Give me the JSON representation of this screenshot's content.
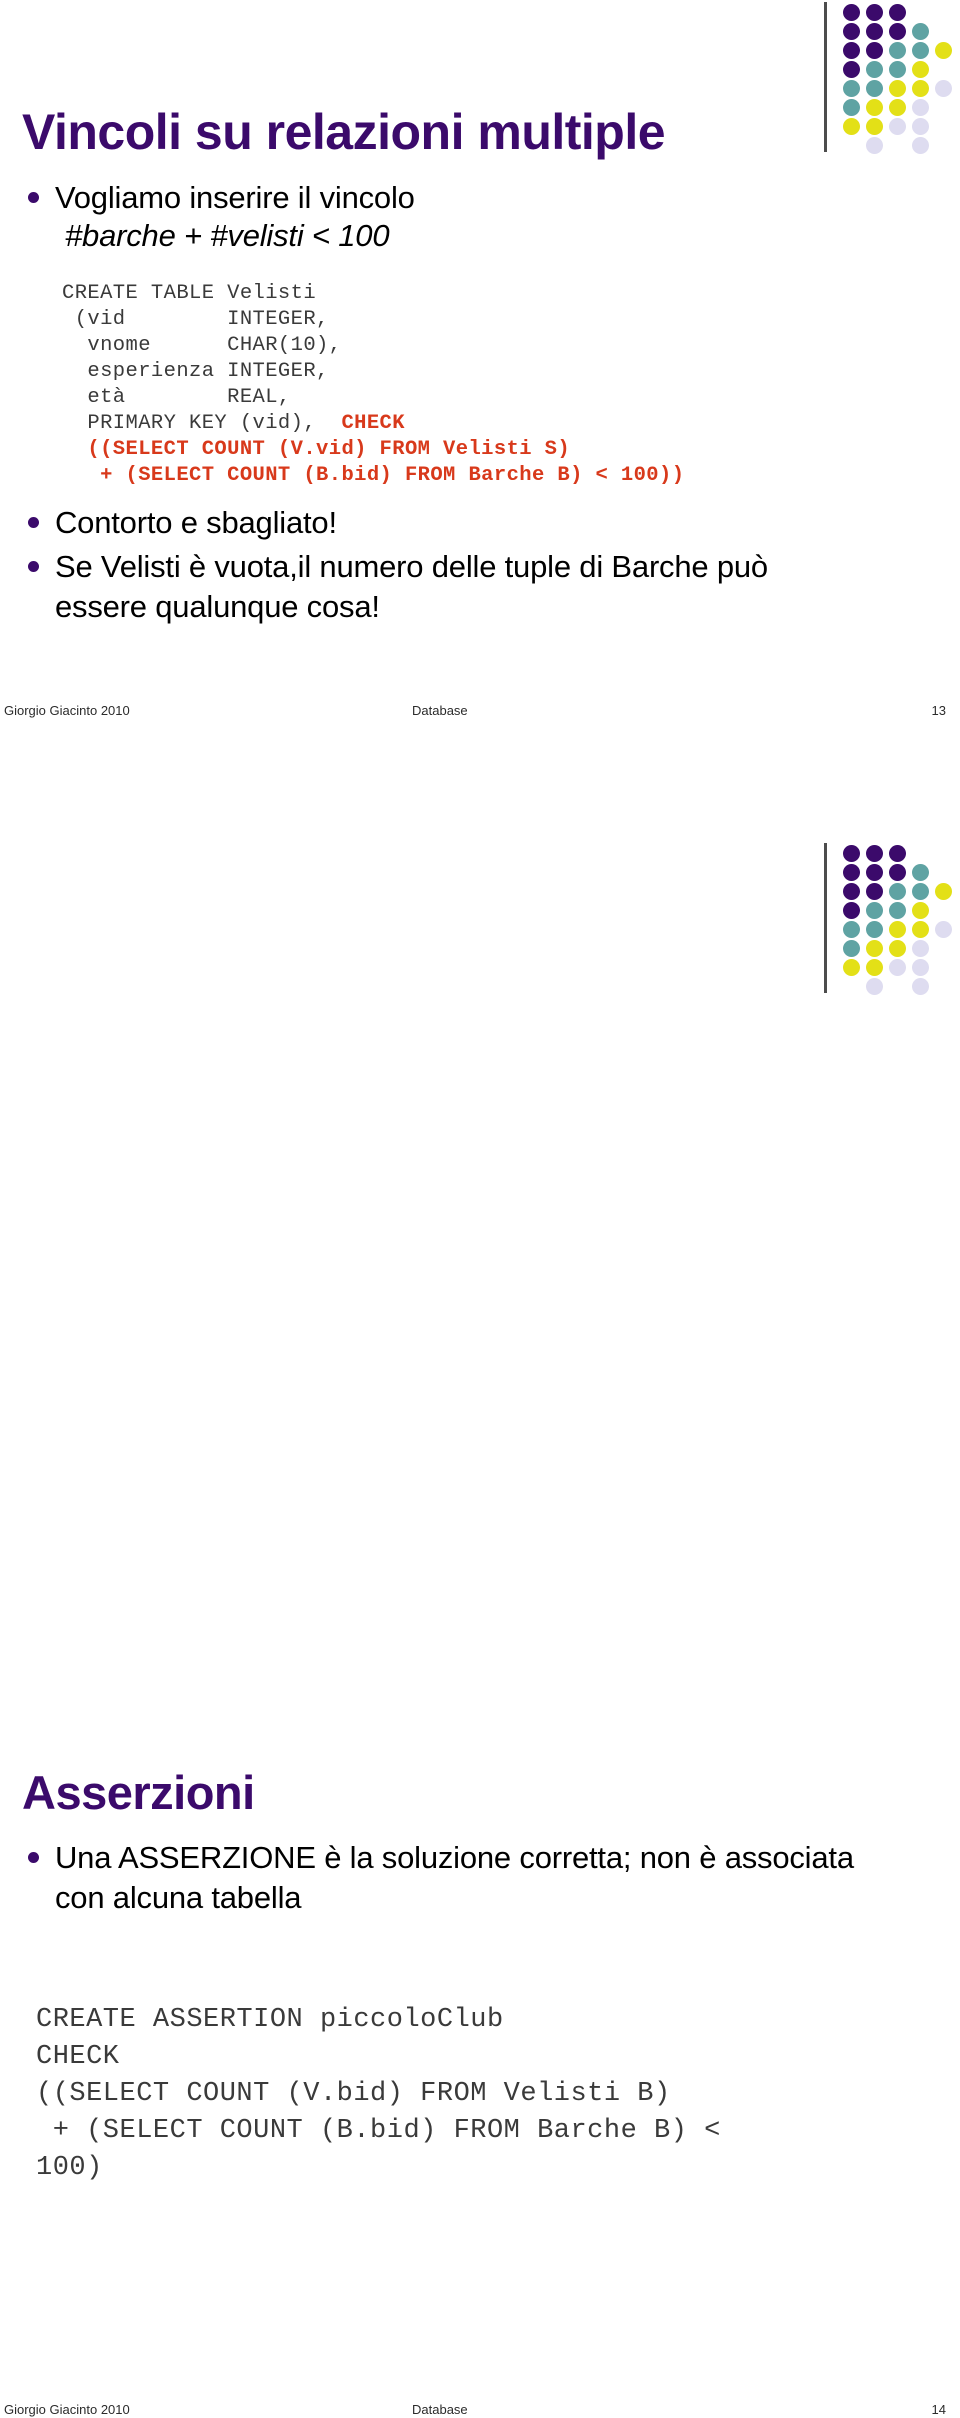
{
  "theme": {
    "title_color": "#3B0A6B",
    "bullet_color": "#3B0A6B",
    "code_color": "#3A3A3A",
    "highlight_color": "#D8391B",
    "deco_purple": "#3B0A6B",
    "deco_teal": "#5FA3A3",
    "deco_yellow": "#E3E017",
    "deco_lavender": "#DEDCF0",
    "rule_color": "#4D4D4D",
    "background": "#FFFFFF"
  },
  "deco_grid": {
    "name": "decorative-dot-grid",
    "columns": 5,
    "rows": 8,
    "cells": [
      [
        "purple",
        "purple",
        "purple",
        "none",
        "none"
      ],
      [
        "purple",
        "purple",
        "purple",
        "teal",
        "none"
      ],
      [
        "purple",
        "purple",
        "teal",
        "teal",
        "yellow"
      ],
      [
        "purple",
        "teal",
        "teal",
        "yellow",
        "none"
      ],
      [
        "teal",
        "teal",
        "yellow",
        "yellow",
        "lavender"
      ],
      [
        "teal",
        "yellow",
        "yellow",
        "lavender",
        "none"
      ],
      [
        "yellow",
        "yellow",
        "lavender",
        "lavender",
        "none"
      ],
      [
        "none",
        "lavender",
        "none",
        "lavender",
        "none"
      ]
    ]
  },
  "slide1": {
    "title": "Vincoli su relazioni multiple",
    "bullet1": "Vogliamo inserire il vincolo",
    "constraint": "#barche + #velisti < 100",
    "code_plain": "CREATE TABLE Velisti\n (vid        INTEGER,\n  vnome      CHAR(10),\n  esperienza INTEGER,\n  età        REAL,\n  PRIMARY KEY (vid),",
    "code_highlight": "  CHECK\n  ((SELECT COUNT (V.vid) FROM Velisti S)\n   + (SELECT COUNT (B.bid) FROM Barche B) < 100))",
    "bullet2": "Contorto e sbagliato!",
    "bullet3": "Se Velisti è vuota,il numero delle tuple di Barche può essere qualunque cosa!",
    "footer": {
      "author": "Giorgio Giacinto 2010",
      "course": "Database",
      "page": "13"
    }
  },
  "slide2": {
    "title": "Asserzioni",
    "bullet1": "Una ASSERZIONE è la soluzione corretta; non è associata con alcuna tabella",
    "code": "CREATE ASSERTION piccoloClub\nCHECK\n((SELECT COUNT (V.bid) FROM Velisti B)\n + (SELECT COUNT (B.bid) FROM Barche B) <\n100)",
    "footer": {
      "author": "Giorgio Giacinto 2010",
      "course": "Database",
      "page": "14"
    }
  }
}
